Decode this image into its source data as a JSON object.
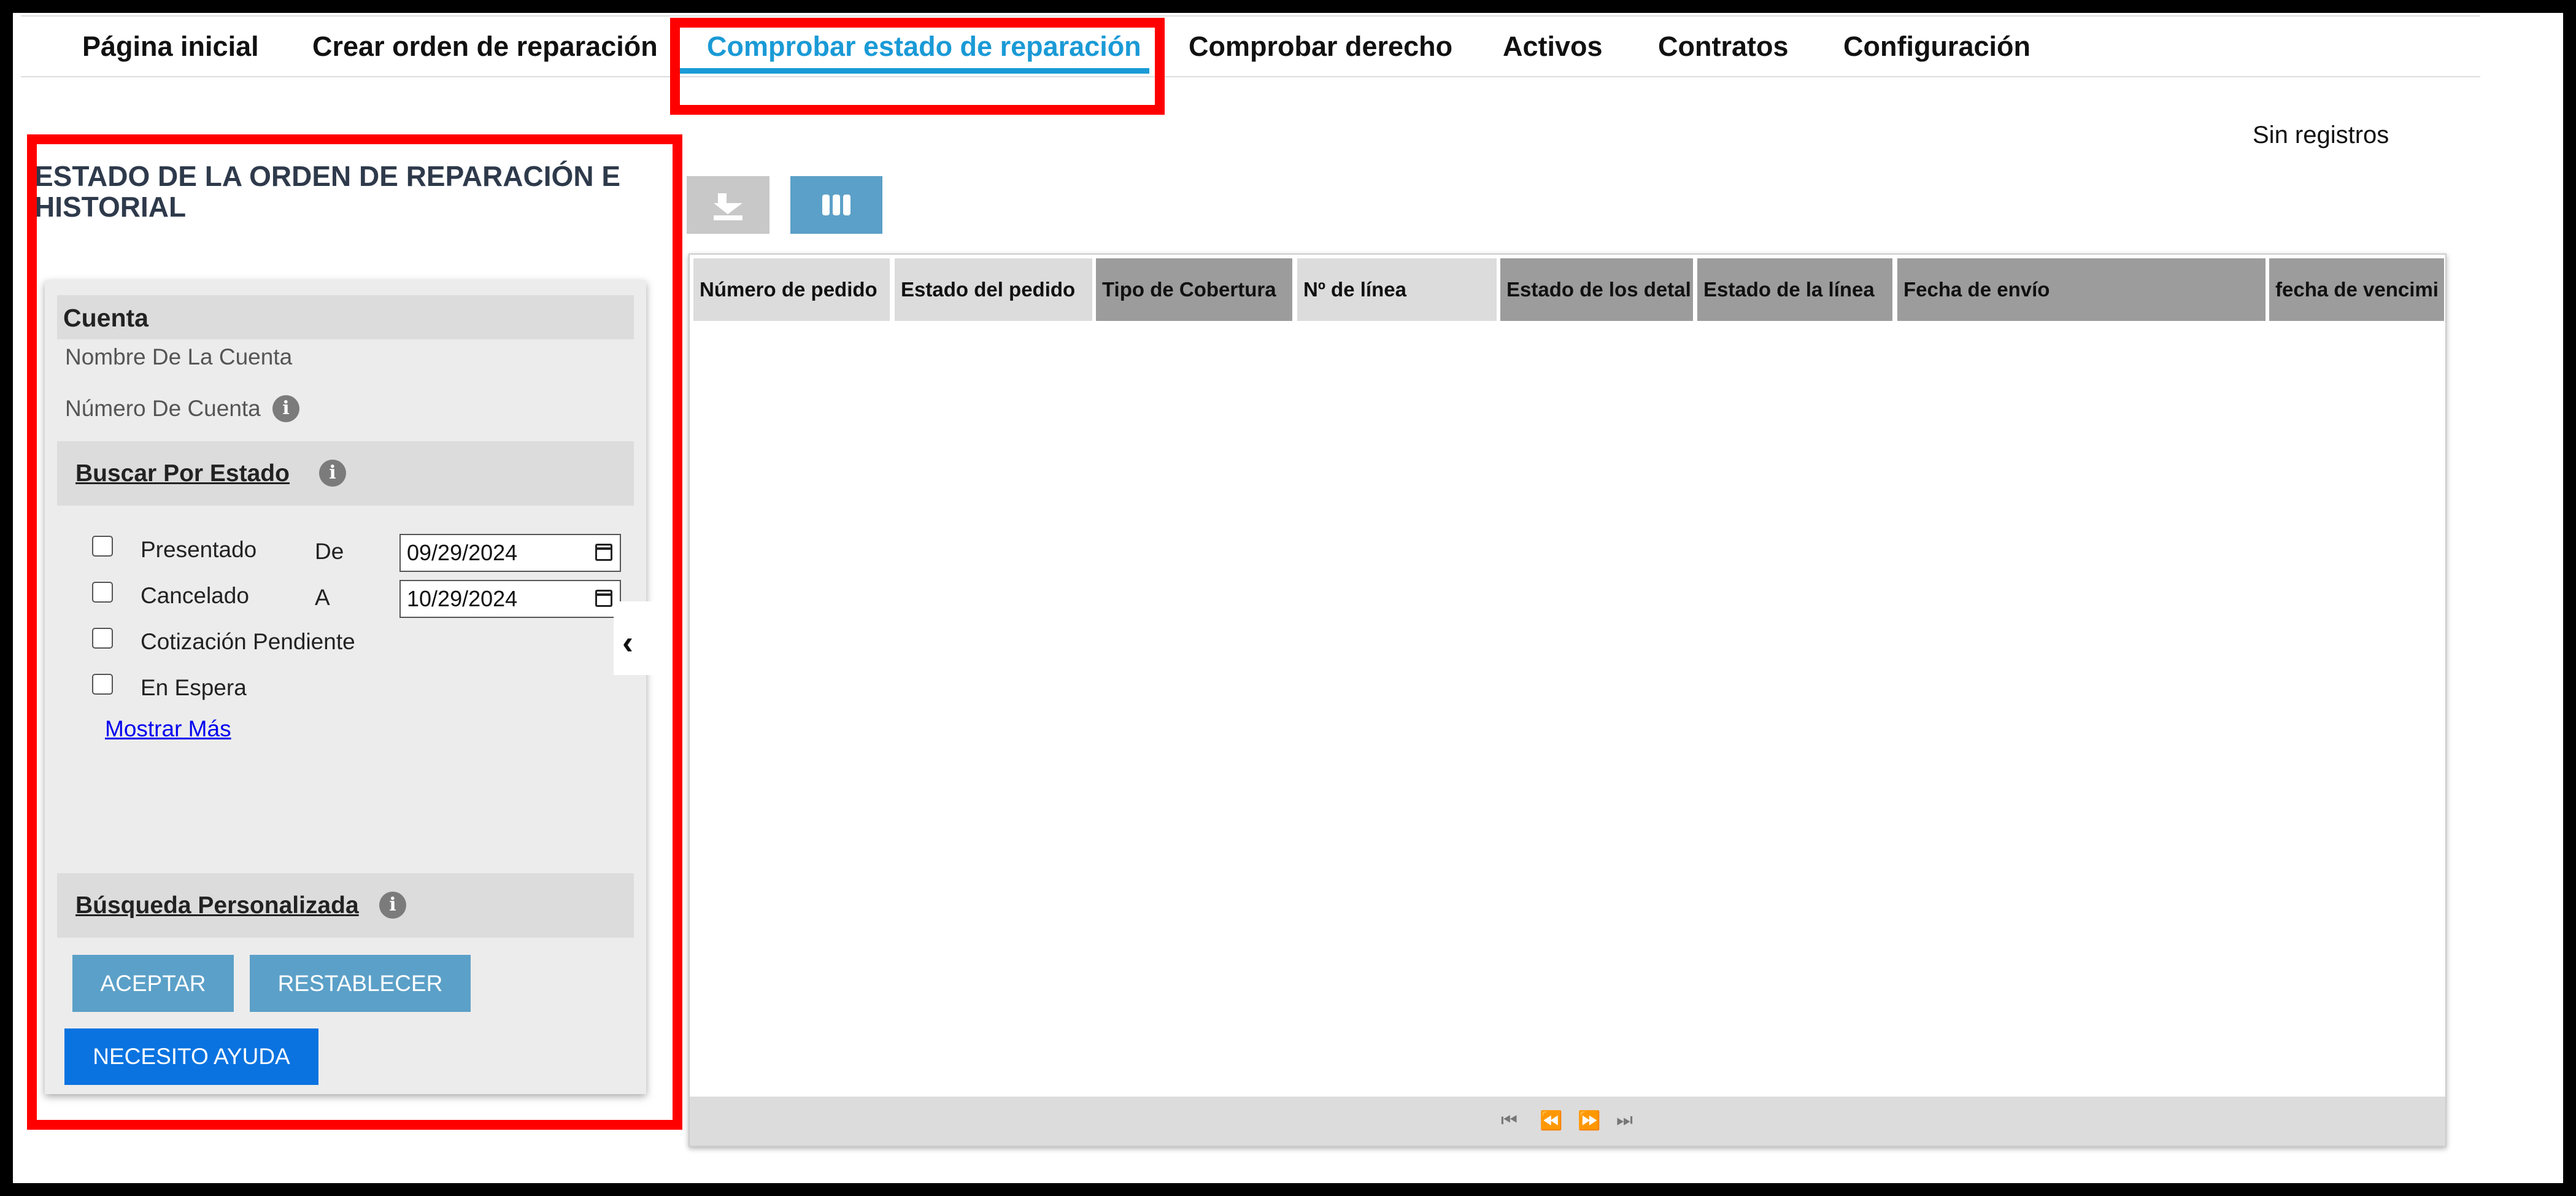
{
  "nav": {
    "items": [
      {
        "label": "Página inicial"
      },
      {
        "label": "Crear orden de reparación"
      },
      {
        "label": "Comprobar estado de reparación"
      },
      {
        "label": "Comprobar derecho"
      },
      {
        "label": "Activos"
      },
      {
        "label": "Contratos"
      },
      {
        "label": "Configuración"
      }
    ],
    "active_index": 2,
    "active_color": "#1a9ad6"
  },
  "panel": {
    "title": "ESTADO DE LA ORDEN DE REPARACIÓN E HISTORIAL",
    "account": {
      "header": "Cuenta",
      "name_label": "Nombre De La Cuenta",
      "number_label": "Número De Cuenta"
    },
    "status_search": {
      "header": "Buscar Por Estado",
      "statuses": [
        {
          "label": "Presentado",
          "checked": false
        },
        {
          "label": "Cancelado",
          "checked": false
        },
        {
          "label": "Cotización Pendiente",
          "checked": false
        },
        {
          "label": "En Espera",
          "checked": false
        }
      ],
      "from_label": "De",
      "from_value": "09/29/2024",
      "to_label": "A",
      "to_value": "10/29/2024",
      "show_more": "Mostrar Más"
    },
    "custom_search": {
      "header": "Búsqueda Personalizada"
    },
    "buttons": {
      "accept": "ACEPTAR",
      "reset": "RESTABLECER",
      "help": "NECESITO AYUDA"
    }
  },
  "grid": {
    "record_count_text": "Sin registros",
    "toolbar": [
      {
        "icon": "download-icon",
        "enabled": false
      },
      {
        "icon": "columns-icon",
        "enabled": true
      }
    ],
    "columns": [
      {
        "label": "Número de pedido"
      },
      {
        "label": "Estado del pedido"
      },
      {
        "label": "Tipo de Cobertura"
      },
      {
        "label": "Nº de línea"
      },
      {
        "label": "Estado de los detal"
      },
      {
        "label": "Estado de la línea"
      },
      {
        "label": "Fecha de envío"
      },
      {
        "label": "fecha de vencimi"
      }
    ],
    "rows": [],
    "pager_icons": [
      "first-page-icon",
      "prev-page-icon",
      "next-page-icon",
      "last-page-icon"
    ]
  },
  "colors": {
    "highlight": "#ff0000",
    "button_blue": "#5ba0c8",
    "help_button": "#0a73e0",
    "panel_bg": "#ececec"
  }
}
